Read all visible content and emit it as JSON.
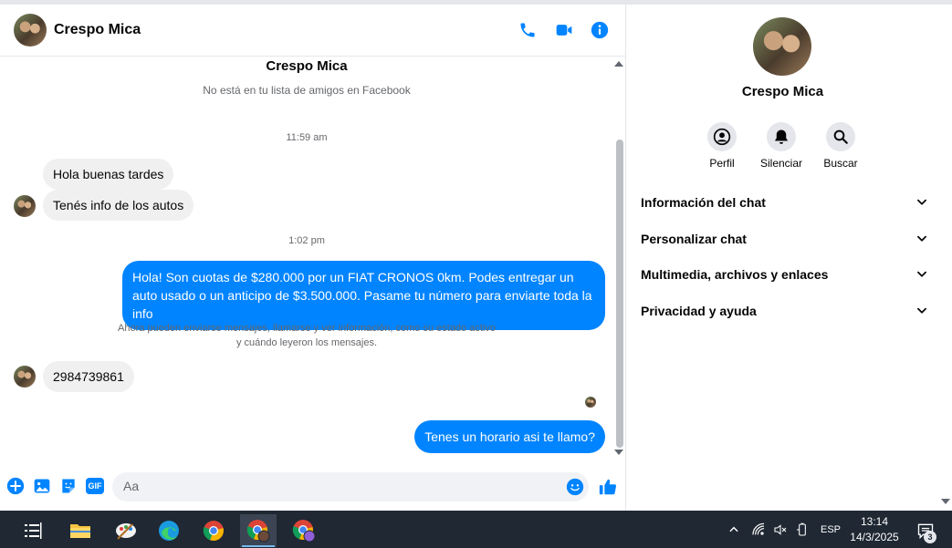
{
  "conversation": {
    "name": "Crespo Mica",
    "subtitle": "No está en tu lista de amigos en Facebook"
  },
  "timestamps": [
    "11:59 am",
    "1:02 pm"
  ],
  "messages": {
    "in1": "Hola buenas tardes",
    "in2": "Tenés info de los autos",
    "out1": "Hola! Son cuotas de $280.000 por un FIAT CRONOS 0km. Podes entregar un auto usado o un anticipo de $3.500.000. Pasame tu número para enviarte toda la info",
    "notice_line1": "Ahora pueden enviarse mensajes, llamarse y ver información, como su estado activo",
    "notice_line2": "y cuándo leyeron los mensajes.",
    "in3": "2984739861",
    "out2": "Tenes un horario asi te llamo?"
  },
  "composer": {
    "placeholder": "Aa",
    "gif_label": "GIF"
  },
  "info_panel": {
    "name": "Crespo Mica",
    "actions": [
      "Perfil",
      "Silenciar",
      "Buscar"
    ],
    "sections": [
      "Información del chat",
      "Personalizar chat",
      "Multimedia, archivos y enlaces",
      "Privacidad y ayuda"
    ]
  },
  "taskbar": {
    "language": "ESP",
    "time": "13:14",
    "date": "14/3/2025",
    "notification_count": "3"
  },
  "colors": {
    "accent": "#0084ff",
    "incoming_bubble": "#f0f0f0",
    "taskbar": "#1f2833"
  }
}
